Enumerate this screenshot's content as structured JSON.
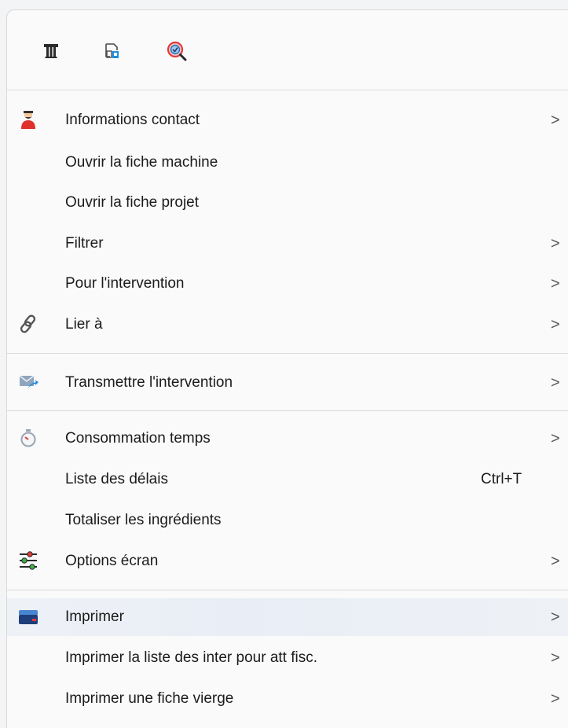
{
  "toolbar": {
    "icons": [
      "text-format-icon",
      "page-setup-icon",
      "search-zoom-icon"
    ]
  },
  "items": [
    {
      "label": "Informations contact",
      "submenu": true,
      "icon": "user-contact-icon"
    },
    {
      "label": "Ouvrir la fiche machine",
      "submenu": false
    },
    {
      "label": "Ouvrir la fiche projet",
      "submenu": false
    },
    {
      "label": "Filtrer",
      "submenu": true
    },
    {
      "label": "Pour l'intervention",
      "submenu": true
    },
    {
      "label": "Lier à",
      "submenu": true,
      "icon": "link-icon"
    },
    {
      "label": "Transmettre l'intervention",
      "submenu": true,
      "icon": "mail-send-icon"
    },
    {
      "label": "Consommation temps",
      "submenu": true,
      "icon": "stopwatch-icon"
    },
    {
      "label": "Liste des délais",
      "submenu": false,
      "shortcut": "Ctrl+T"
    },
    {
      "label": "Totaliser les ingrédients",
      "submenu": false
    },
    {
      "label": "Options écran",
      "submenu": true,
      "icon": "sliders-icon"
    },
    {
      "label": "Imprimer",
      "submenu": true,
      "icon": "printer-icon"
    },
    {
      "label": "Imprimer la liste des inter pour att fisc.",
      "submenu": true
    },
    {
      "label": "Imprimer une fiche vierge",
      "submenu": true
    }
  ],
  "chevron": ">"
}
